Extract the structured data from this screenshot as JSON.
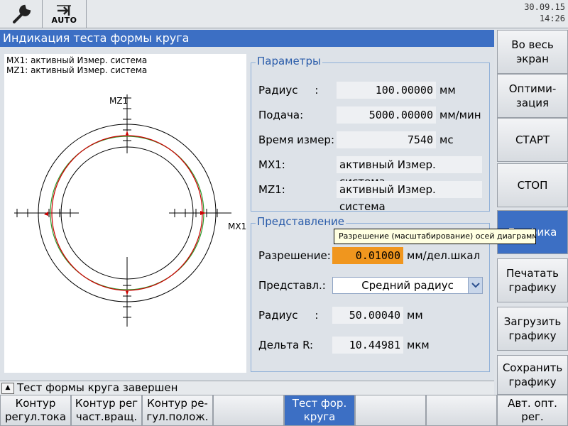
{
  "header": {
    "date": "30.09.15",
    "time": "14:26",
    "mode_label": "AUTO"
  },
  "title": "Индикация теста формы круга",
  "plot": {
    "info_line1": "MX1: активный Измер. система",
    "info_line2": "MZ1: активный Измер. система",
    "axis_v_label": "MZ1",
    "axis_h_label": "MX1"
  },
  "parameters": {
    "title": "Параметры",
    "radius_label": "Радиус     :",
    "radius_value": "100.00000",
    "radius_unit": "мм",
    "feed_label": "Подача:",
    "feed_value": "5000.00000",
    "feed_unit": "мм/мин",
    "meas_time_label": "Время измер:",
    "meas_time_value": "7540",
    "meas_time_unit": "мс",
    "mx1_label": "MX1:",
    "mx1_value": "активный Измер. система",
    "mz1_label": "MZ1:",
    "mz1_value": "активный Измер. система"
  },
  "representation": {
    "title": "Представление",
    "resolution_label": "Разрешение:",
    "resolution_value": "0.01000",
    "resolution_unit": "мм/дел.шкал",
    "display_label": "Представл.:",
    "display_value": "Средний радиус",
    "radius_label": "Радиус     :",
    "radius_value": "50.00040",
    "radius_unit": "мм",
    "delta_label": "Дельта R:",
    "delta_value": "10.44981",
    "delta_unit": "мкм"
  },
  "tooltip": "Разрешение (масштабирование) осей диаграммы",
  "status": "Тест формы круга завершен",
  "softkeys_right": [
    {
      "label": "Во весь\nэкран"
    },
    {
      "label": "Оптими-\nзация"
    },
    {
      "label": "СТАРТ"
    },
    {
      "label": "СТОП"
    },
    {
      "label": "Графика"
    },
    {
      "label": "Печатать\nграфику"
    },
    {
      "label": "Загрузить\nграфику"
    },
    {
      "label": "Сохранить\nграфику"
    }
  ],
  "softkeys_bottom": [
    {
      "label": "Контур\nрегул.тока"
    },
    {
      "label": "Контур рег\nчаст.вращ."
    },
    {
      "label": "Контур ре-\nгул.полож."
    },
    {
      "label": ""
    },
    {
      "label": "Тест фор.\nкруга"
    },
    {
      "label": ""
    },
    {
      "label": ""
    },
    {
      "label": "Авт. опт.\nрег."
    }
  ],
  "colors": {
    "accent": "#3c6fc4",
    "highlight": "#f0961e",
    "trace_red": "#cc0000",
    "trace_green": "#2e9a2e"
  }
}
